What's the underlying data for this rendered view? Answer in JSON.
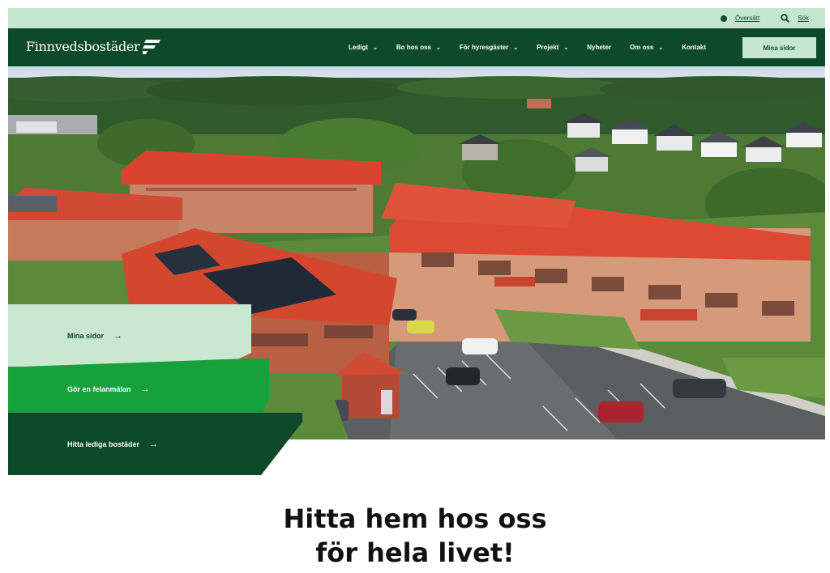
{
  "utility_bar": {
    "language": "Översätt",
    "search": "Sök"
  },
  "header": {
    "logo_text": "Finnvedsbostäder",
    "nav": [
      {
        "label": "Ledigt",
        "chevron": "chevron-down-icon"
      },
      {
        "label": "Bo hos oss",
        "chevron": "chevron-down-icon"
      },
      {
        "label": "För hyresgäster",
        "chevron": "chevron-down-icon"
      },
      {
        "label": "Projekt",
        "chevron": "chevron-down-icon"
      },
      {
        "label": "Nyheter"
      },
      {
        "label": "Om oss",
        "chevron": "chevron-down-icon"
      },
      {
        "label": "Kontakt"
      }
    ],
    "cta": "Mina sidor"
  },
  "actions": [
    {
      "label": "Mina sidor",
      "icon": "arrow-right-icon"
    },
    {
      "label": "Gör en felanmälan",
      "icon": "arrow-right-icon"
    },
    {
      "label": "Hitta lediga bostäder",
      "icon": "arrow-right-icon"
    }
  ],
  "headline": {
    "line1": "Hitta hem hos oss",
    "line2": "för hela livet!"
  },
  "colors": {
    "dark_green": "#0e4a2a",
    "bright_green": "#17a13c",
    "light_green": "#c6e6cf",
    "roof_red": "#d9432f"
  }
}
